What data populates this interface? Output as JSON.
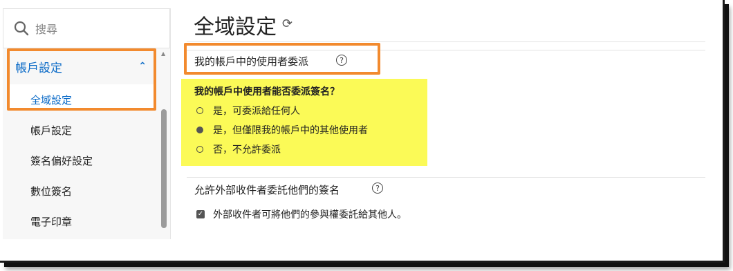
{
  "search": {
    "placeholder": "搜尋"
  },
  "sidebar": {
    "section_label": "帳戶設定",
    "items": [
      {
        "label": "全域設定",
        "active": true
      },
      {
        "label": "帳戶設定"
      },
      {
        "label": "簽名偏好設定"
      },
      {
        "label": "數位簽名"
      },
      {
        "label": "電子印章"
      }
    ]
  },
  "main": {
    "title": "全域設定",
    "section1": {
      "title": "我的帳戶中的使用者委派",
      "question": "我的帳戶中使用者能否委派簽名？",
      "options": [
        {
          "label": "是，可委派給任何人",
          "selected": false
        },
        {
          "label": "是，但僅限我的帳戶中的其他使用者",
          "selected": true
        },
        {
          "label": "否，不允許委派",
          "selected": false
        }
      ]
    },
    "section2": {
      "title": "允許外部收件者委託他們的簽名",
      "checkbox_label": "外部收件者可將他們的參與權委託給其他人。",
      "checked": true
    }
  },
  "colors": {
    "accent": "#0a6ac7",
    "highlight_orange": "#f28a2e",
    "highlight_yellow": "#fbfa57"
  }
}
